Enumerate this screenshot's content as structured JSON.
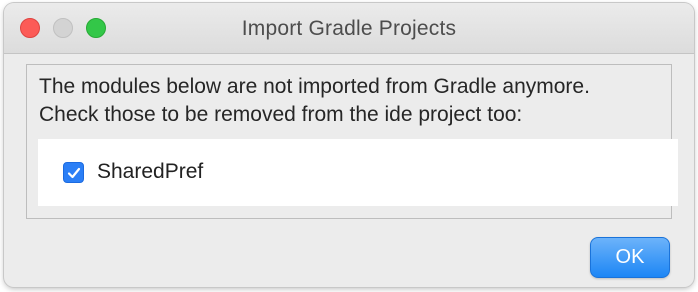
{
  "window": {
    "title": "Import Gradle Projects"
  },
  "traffic_lights": {
    "close_color": "#fc5b57",
    "minimize_color": "#d3d3d3",
    "maximize_color": "#33c748"
  },
  "message": {
    "line1": "The modules below are not imported from Gradle anymore.",
    "line2": "Check those to be removed from the ide project too:"
  },
  "modules": [
    {
      "label": "SharedPref",
      "checked": true,
      "check_icon": "checkmark-icon"
    }
  ],
  "buttons": {
    "ok_label": "OK"
  },
  "colors": {
    "accent": "#2b7ff6"
  }
}
